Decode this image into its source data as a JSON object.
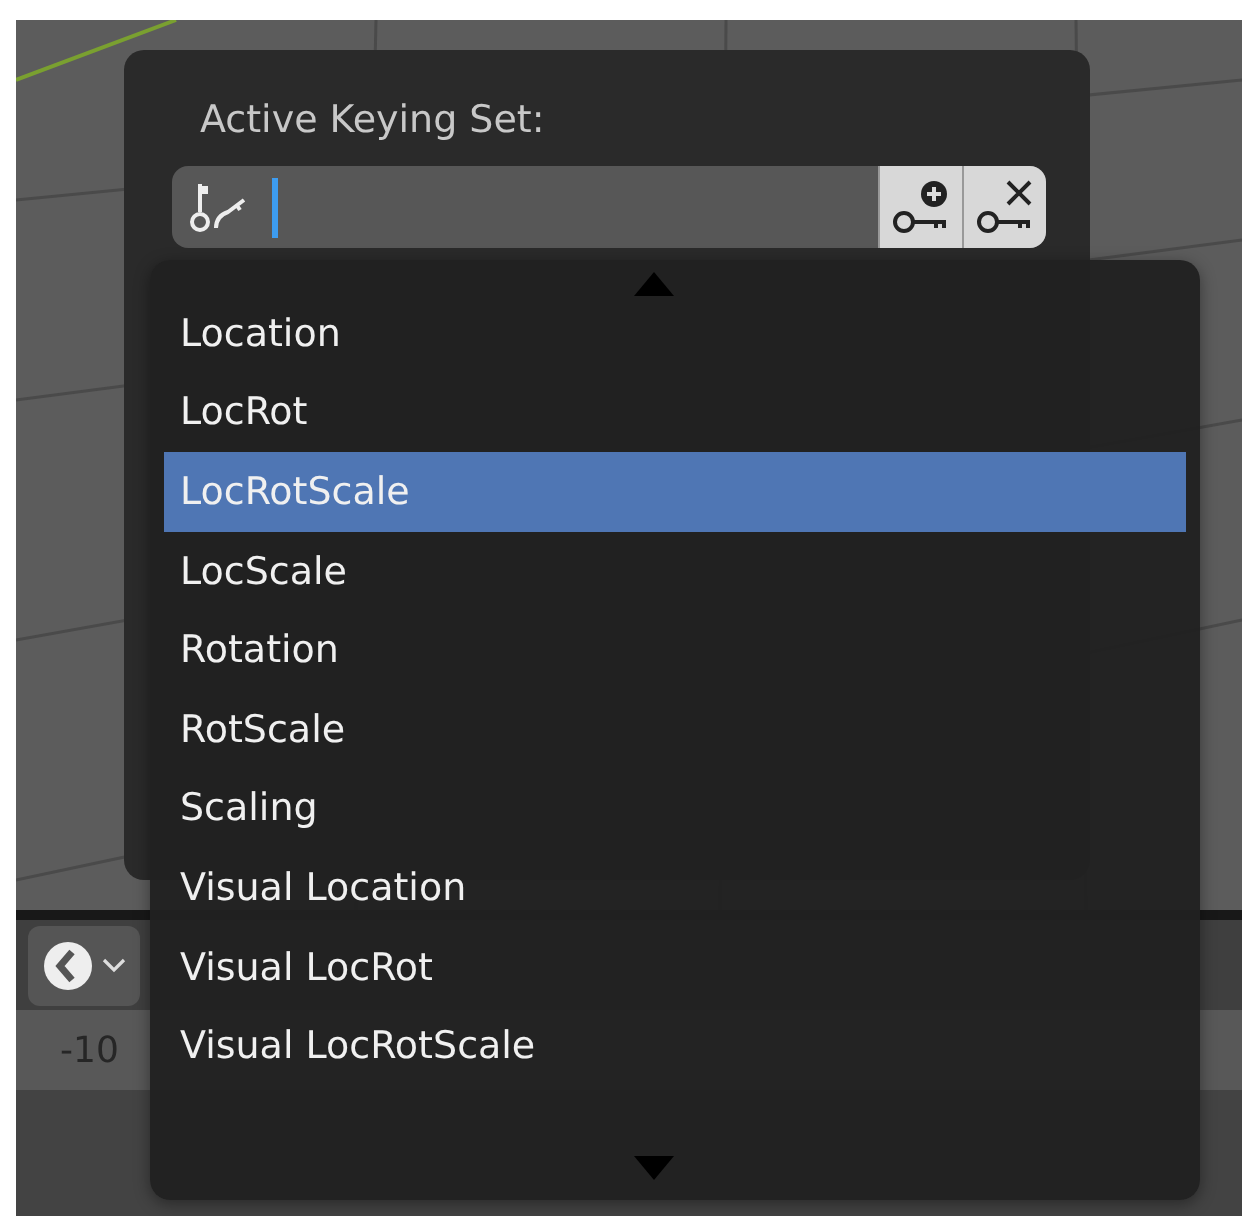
{
  "popover": {
    "title": "Active Keying Set:"
  },
  "menu": {
    "items": [
      {
        "label": "Location",
        "selected": false
      },
      {
        "label": "LocRot",
        "selected": false
      },
      {
        "label": "LocRotScale",
        "selected": true
      },
      {
        "label": "LocScale",
        "selected": false
      },
      {
        "label": "Rotation",
        "selected": false
      },
      {
        "label": "RotScale",
        "selected": false
      },
      {
        "label": "Scaling",
        "selected": false
      },
      {
        "label": "Visual Location",
        "selected": false
      },
      {
        "label": "Visual LocRot",
        "selected": false
      },
      {
        "label": "Visual LocRotScale",
        "selected": false
      }
    ]
  },
  "timeline": {
    "ruler": [
      "-10"
    ]
  }
}
